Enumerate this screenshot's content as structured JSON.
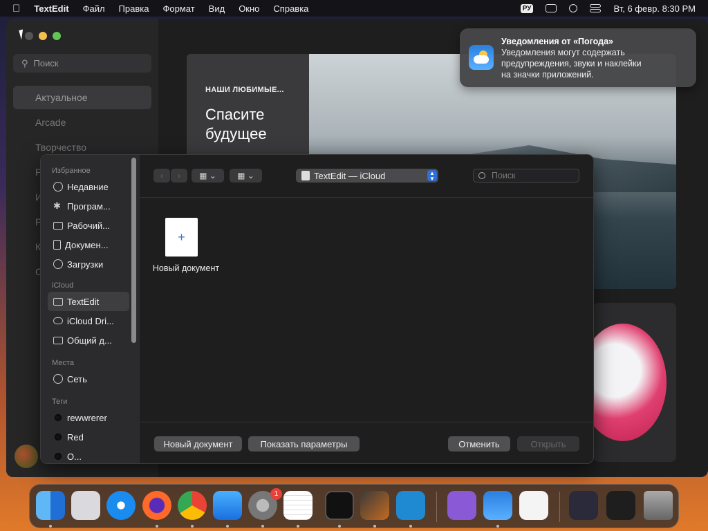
{
  "menubar": {
    "app": "TextEdit",
    "menus": [
      "Файл",
      "Правка",
      "Формат",
      "Вид",
      "Окно",
      "Справка"
    ],
    "input_source": "РУ",
    "datetime": "Вт, 6 февр.  8:30 PM"
  },
  "appstore": {
    "search_placeholder": "Поиск",
    "nav": [
      "Актуальное",
      "Arcade",
      "Творчество",
      "Р",
      "И",
      "Р",
      "К",
      "О"
    ],
    "hero": {
      "kicker": "НАШИ ЛЮБИМЫЕ...",
      "title_line1": "Спасите",
      "title_line2": "будущее"
    }
  },
  "notification": {
    "title": "Уведомления от «Погода»",
    "body_line1": "Уведомления могут содержать",
    "body_line2": "предупреждения, звуки и наклейки",
    "body_line3": "на значки приложений."
  },
  "dialog": {
    "sidebar": {
      "favorites_header": "Избранное",
      "favorites": [
        "Недавние",
        "Програм...",
        "Рабочий...",
        "Докумен...",
        "Загрузки"
      ],
      "icloud_header": "iCloud",
      "icloud": [
        "TextEdit",
        "iCloud Dri...",
        "Общий д..."
      ],
      "places_header": "Места",
      "places": [
        "Сеть"
      ],
      "tags_header": "Теги",
      "tags": [
        "rewwrerer",
        "Red",
        "O..."
      ]
    },
    "toolbar": {
      "back": "‹",
      "forward": "›",
      "location": "TextEdit — iCloud",
      "search_placeholder": "Поиск"
    },
    "content": {
      "new_doc_label": "Новый документ",
      "new_doc_plus": "+"
    },
    "footer": {
      "new_document": "Новый документ",
      "show_options": "Показать параметры",
      "cancel": "Отменить",
      "open": "Открыть"
    }
  },
  "dock": {
    "settings_badge": "1"
  }
}
